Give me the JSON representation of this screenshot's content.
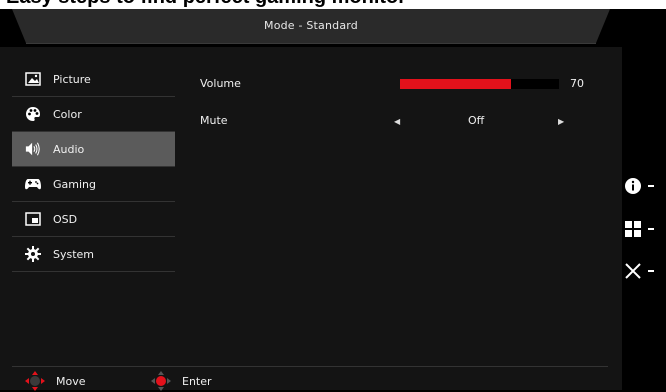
{
  "top_banner_text": "Easy steps to find perfect gaming monitor",
  "header": {
    "title": "Mode - Standard"
  },
  "menu": {
    "items": [
      {
        "label": "Picture",
        "icon": "picture-icon"
      },
      {
        "label": "Color",
        "icon": "palette-icon"
      },
      {
        "label": "Audio",
        "icon": "speaker-icon",
        "active": true
      },
      {
        "label": "Gaming",
        "icon": "gamepad-icon"
      },
      {
        "label": "OSD",
        "icon": "osd-window-icon"
      },
      {
        "label": "System",
        "icon": "gear-icon"
      }
    ]
  },
  "settings": {
    "volume": {
      "label": "Volume",
      "value": "70",
      "level": 0.7
    },
    "mute": {
      "label": "Mute",
      "value": "Off"
    }
  },
  "footer": {
    "move_label": "Move",
    "enter_label": "Enter"
  },
  "side_buttons": [
    "info-icon",
    "grid-icon",
    "close-icon"
  ],
  "colors": {
    "accent": "#e3111b",
    "active_item": "#5b5b5b",
    "panel": "#141414"
  }
}
